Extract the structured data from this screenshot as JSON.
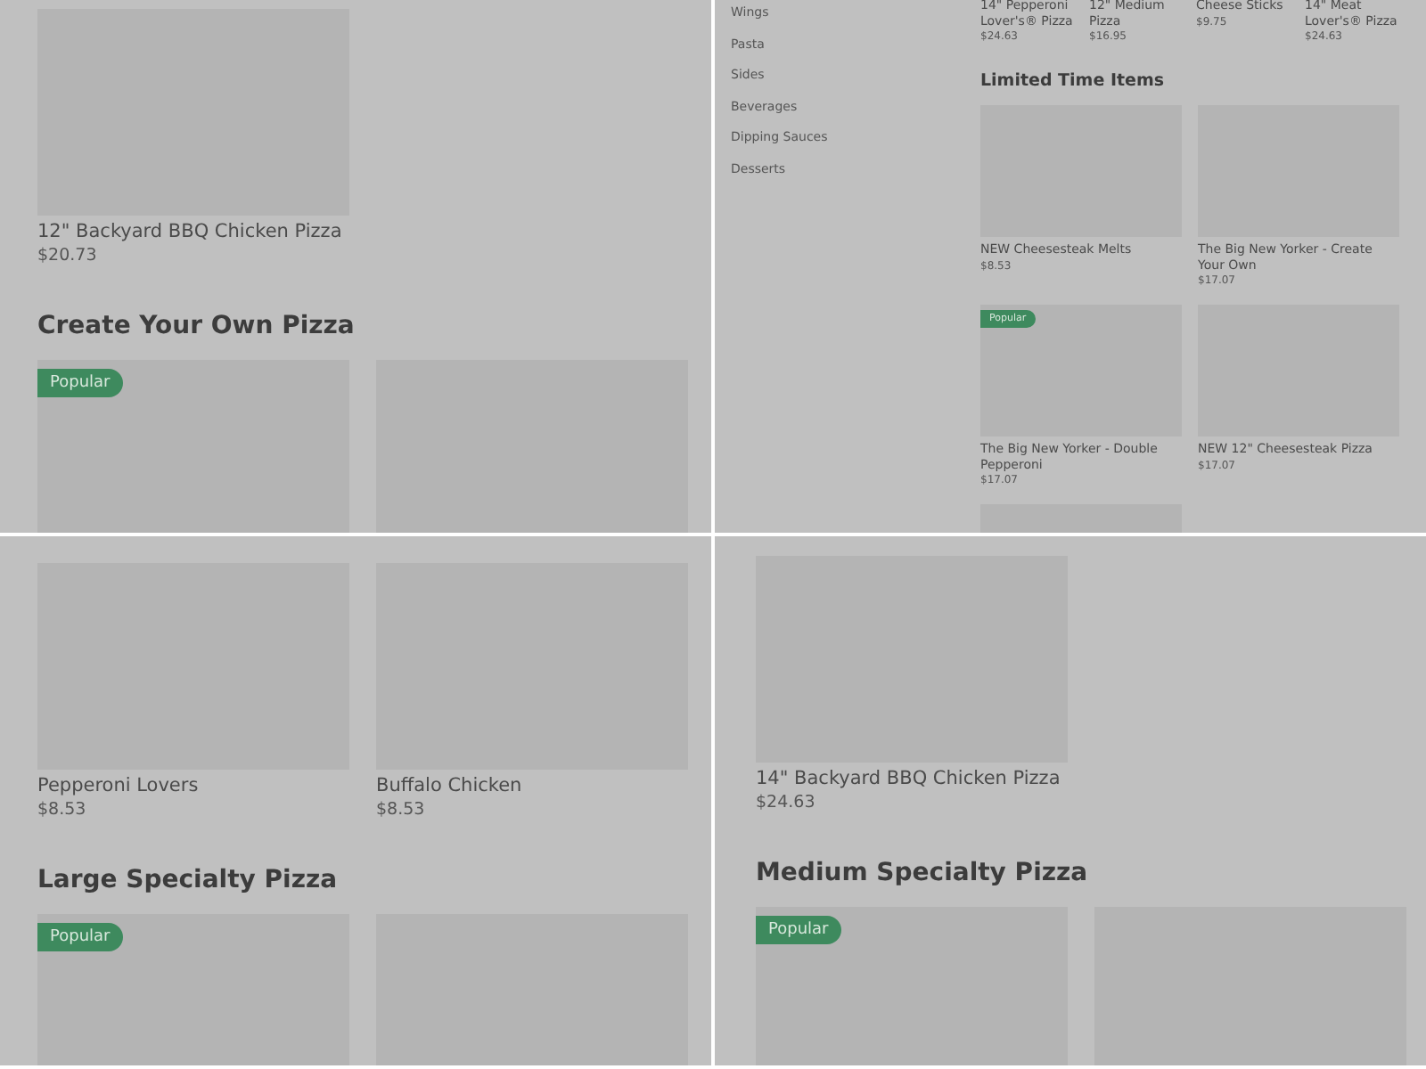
{
  "panes": [
    {
      "blocks": [
        {
          "kind": "grid",
          "cards": [
            {
              "kind": "product",
              "title": "12\" Backyard BBQ Chicken Pizza",
              "price": "$20.73"
            }
          ]
        },
        {
          "kind": "heading",
          "text": "Create Your Own Pizza"
        },
        {
          "kind": "grid",
          "cards": [
            {
              "kind": "product",
              "badge": "Popular"
            },
            {
              "kind": "product"
            }
          ]
        }
      ]
    },
    {
      "sidebar": [
        "Wings",
        "Pasta",
        "Sides",
        "Beverages",
        "Dipping Sauces",
        "Desserts"
      ],
      "blocks": [
        {
          "kind": "text_row",
          "cards": [
            {
              "title": "14\" Pepperoni Lover's® Pizza",
              "price": "$24.63"
            },
            {
              "title": "12\" Medium Pizza",
              "price": "$16.95"
            },
            {
              "title": "Cheese Sticks",
              "price": "$9.75"
            },
            {
              "title": "14\" Meat Lover's® Pizza",
              "price": "$24.63"
            }
          ]
        },
        {
          "kind": "heading",
          "text": "Limited Time Items"
        },
        {
          "kind": "grid",
          "cards": [
            {
              "kind": "product",
              "title": "NEW Cheesesteak Melts",
              "price": "$8.53"
            },
            {
              "kind": "product",
              "title": "The Big New Yorker - Create Your Own",
              "price": "$17.07"
            },
            {
              "kind": "product",
              "title": "The Big New Yorker - Double Pepperoni",
              "price": "$17.07",
              "badge": "Popular"
            },
            {
              "kind": "product",
              "title": "NEW 12\" Cheesesteak Pizza",
              "price": "$17.07"
            },
            {
              "kind": "product"
            }
          ]
        }
      ]
    },
    {
      "blocks": [
        {
          "kind": "grid",
          "cards": [
            {
              "kind": "product",
              "title": "Pepperoni Lovers",
              "price": "$8.53"
            },
            {
              "kind": "product",
              "title": "Buffalo Chicken",
              "price": "$8.53"
            }
          ]
        },
        {
          "kind": "heading",
          "text": "Large Specialty Pizza"
        },
        {
          "kind": "grid",
          "cards": [
            {
              "kind": "product",
              "badge": "Popular"
            },
            {
              "kind": "product"
            }
          ]
        }
      ]
    },
    {
      "blocks": [
        {
          "kind": "grid",
          "cards": [
            {
              "kind": "product",
              "title": "14\" Backyard BBQ Chicken Pizza",
              "price": "$24.63"
            }
          ]
        },
        {
          "kind": "heading",
          "text": "Medium Specialty Pizza"
        },
        {
          "kind": "grid",
          "cards": [
            {
              "kind": "product",
              "badge": "Popular"
            },
            {
              "kind": "product"
            }
          ]
        }
      ]
    }
  ]
}
